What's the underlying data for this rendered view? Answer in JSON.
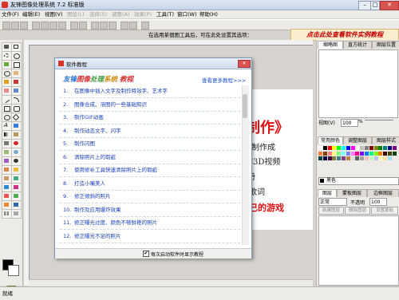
{
  "app": {
    "title": "友锋图像处理系统 7.2 标准版",
    "window_min": "–",
    "window_max": "□",
    "window_close": "✕"
  },
  "menu": [
    {
      "label": "文件(F)",
      "enabled": true
    },
    {
      "label": "编辑(E)",
      "enabled": true
    },
    {
      "label": "视图(V)",
      "enabled": true
    },
    {
      "label": "图层(L)",
      "enabled": false
    },
    {
      "label": "选择(S)",
      "enabled": false
    },
    {
      "label": "调整(A)",
      "enabled": false
    },
    {
      "label": "效果(P)",
      "enabled": false
    },
    {
      "label": "工具(T)",
      "enabled": true
    },
    {
      "label": "窗口(W)",
      "enabled": true
    },
    {
      "label": "帮助(H)",
      "enabled": true
    }
  ],
  "toolbar": {
    "hint": "在选用某個图工具后，可在此处设置其选项：",
    "banner": "点击此处查看软件实例教程"
  },
  "canvas": {
    "line1": "制作》",
    "line2": "片制作成",
    "line3": "作3D视频",
    "line4": "册",
    "line5": "歌词",
    "line6": "己的游戏"
  },
  "right": {
    "tabs_top": [
      "缩略图",
      "直方统计",
      "图层位置"
    ],
    "view_label": "视图(V)",
    "view_value": "100",
    "view_unit": "%",
    "color_tabs": [
      "常用颜色",
      "调整图层",
      "图层样式"
    ],
    "color_name": "黑色",
    "layer_tabs": [
      "图层",
      "蒙板图层",
      "边框图层"
    ],
    "blend_mode": "正常",
    "opacity_label": "不透明",
    "opacity_value": "100",
    "layer_buttons": [
      "新建图层",
      "删除图层",
      "设置蒙板"
    ],
    "palette": [
      "#ffffff",
      "#000000",
      "#ff0000",
      "#ffff00",
      "#00ff00",
      "#00ffff",
      "#0000ff",
      "#ff00ff",
      "#ffffff",
      "#c0c0c0",
      "#808080",
      "#800000",
      "#808000",
      "#008000",
      "#008080",
      "#000080",
      "#800080",
      "#ff8040",
      "#804000",
      "#ff8080",
      "#ffff80",
      "#80ff80",
      "#80ffff",
      "#8080ff",
      "#ff80ff",
      "#ff0080",
      "#8000ff",
      "#0080ff",
      "#00ff80",
      "#80ff00",
      "#ff8000",
      "#400000",
      "#404000",
      "#004000",
      "#004040",
      "#000040",
      "#400040",
      "#808040",
      "#408080",
      "#804080",
      "#c08040",
      "#e0e0e0",
      "#606060",
      "#a0a0a0",
      "#ffc0c0",
      "#c0ffc0",
      "#c0c0ff",
      "#ffffc0",
      "#ffe0a0",
      "#a0e0ff"
    ]
  },
  "dialog": {
    "title": "软件教程",
    "brand": [
      "友锋",
      "图像",
      "处理",
      "系统",
      " 教程"
    ],
    "more_link": "查看更多教程>>>",
    "items": [
      "在图像中插入文字及制作特效字、艺术字",
      "图像合成、溶图的一些基础知识",
      "制作GIF动画",
      "制作动态文字、闪字",
      "制作闪图",
      "清除照片上的瑕疵",
      "使用修补工具快速清除照片上的瑕疵",
      "打造小嘴美人",
      "修正倾斜的照片",
      "制作及应用爆炸效果",
      "修正曝光过度、颜色不够鲜艳的照片",
      "修正曝光不足的照片"
    ],
    "item_numbers": [
      "1.",
      "2.",
      "3.",
      "4.",
      "5.",
      "6.",
      "7.",
      "8.",
      "9.",
      "10.",
      "11.",
      "12."
    ],
    "checkbox_mark": "✔",
    "footer_label": "每次启动软件时显示教程"
  },
  "status": {
    "text": "就绪"
  }
}
